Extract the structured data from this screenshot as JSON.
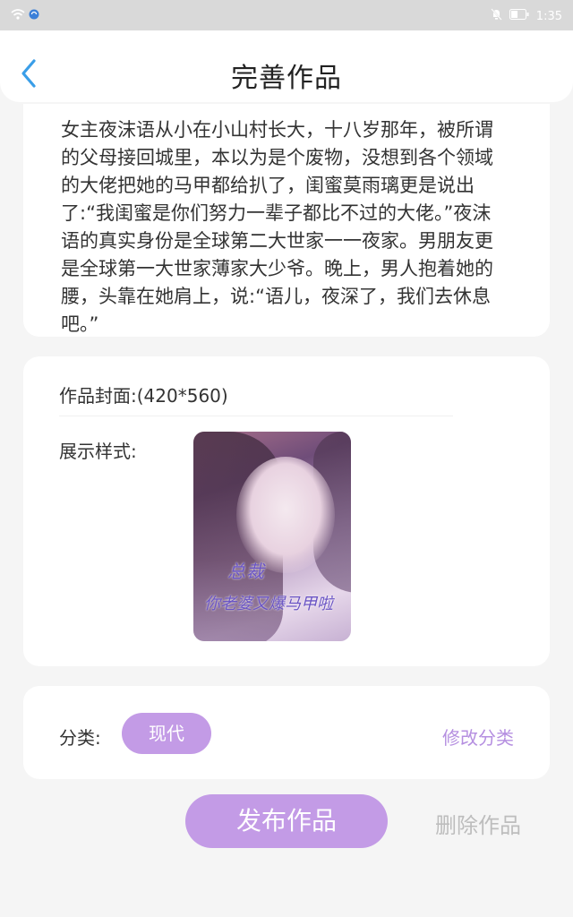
{
  "status_bar": {
    "time": "1:35",
    "icons": [
      "wifi-icon",
      "sync-icon",
      "mute-icon",
      "battery-icon"
    ]
  },
  "header": {
    "back_icon": "chevron-left-icon",
    "title": "完善作品"
  },
  "description": {
    "text": "女主夜沫语从小在小山村长大，十八岁那年，被所谓的父母接回城里，本以为是个废物，没想到各个领域的大佬把她的马甲都给扒了，闺蜜莫雨璃更是说出了:“我闺蜜是你们努力一辈子都比不过的大佬。”夜沫语的真实身份是全球第二大世家一一夜家。男朋友更是全球第一大世家薄家大少爷。晚上，男人抱着她的腰，头靠在她肩上，说:“语儿，夜深了，我们去休息吧。”"
  },
  "cover": {
    "label": "作品封面:(420*560)",
    "style_label": "展示样式:",
    "image_title_line1": "总裁",
    "image_title_line2": "你老婆又爆马甲啦"
  },
  "category": {
    "label": "分类:",
    "value": "现代",
    "modify_label": "修改分类"
  },
  "actions": {
    "publish_label": "发布作品",
    "delete_label": "删除作品"
  },
  "colors": {
    "accent": "#c39be6",
    "link": "#b58fe0",
    "back_icon": "#3a9ee8",
    "disabled_text": "#bdbdbd"
  }
}
